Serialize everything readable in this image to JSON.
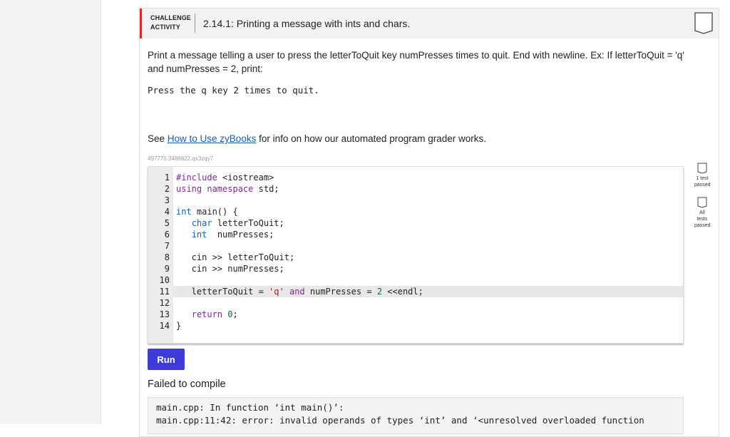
{
  "header": {
    "tag": "CHALLENGE ACTIVITY",
    "title": "2.14.1: Printing a message with ints and chars."
  },
  "prompt": "Print a message telling a user to press the letterToQuit key numPresses times to quit. End with newline. Ex: If letterToQuit = 'q' and numPresses = 2, print:",
  "expected_output": "Press the q key 2 times to quit.",
  "see": {
    "prefix": "See ",
    "link": "How to Use zyBooks",
    "suffix": " for info on how our automated program grader works."
  },
  "code_id": "497770.3488822.qx3zqy7",
  "code_lines": [
    {
      "n": "1",
      "text": "#include <iostream>"
    },
    {
      "n": "2",
      "text": "using namespace std;"
    },
    {
      "n": "3",
      "text": ""
    },
    {
      "n": "4",
      "text": "int main() {"
    },
    {
      "n": "5",
      "text": "   char letterToQuit;"
    },
    {
      "n": "6",
      "text": "   int  numPresses;"
    },
    {
      "n": "7",
      "text": ""
    },
    {
      "n": "8",
      "text": "   cin >> letterToQuit;"
    },
    {
      "n": "9",
      "text": "   cin >> numPresses;"
    },
    {
      "n": "10",
      "text": ""
    },
    {
      "n": "11",
      "text": "   letterToQuit = 'q' and numPresses = 2 <<endl;"
    },
    {
      "n": "12",
      "text": ""
    },
    {
      "n": "13",
      "text": "   return 0;"
    },
    {
      "n": "14",
      "text": "}"
    }
  ],
  "status": {
    "test1": "1 test passed",
    "all": "All tests passed"
  },
  "run_label": "Run",
  "fail_title": "Failed to compile",
  "errors": [
    "main.cpp: In function ‘int main()’:",
    "main.cpp:11:42: error: invalid operands of types ‘int’ and ‘<unresolved overloaded function"
  ],
  "colors": {
    "accent_red": "#d0312d",
    "run_button": "#3f3bdb",
    "link": "#1a5fb4"
  }
}
